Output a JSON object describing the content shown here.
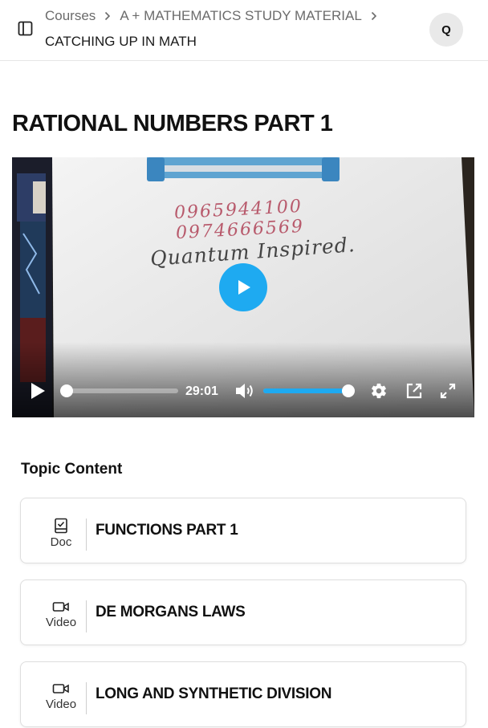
{
  "header": {
    "breadcrumbs": [
      "Courses",
      "A + MATHEMATICS STUDY MATERIAL"
    ],
    "current": "CATCHING UP IN MATH",
    "avatar_initial": "Q"
  },
  "page_title": "RATIONAL NUMBERS PART 1",
  "video": {
    "handwriting": {
      "phone_1": "0965944100",
      "phone_2": "0974666569",
      "signature": "Quantum Inspired."
    },
    "duration": "29:01",
    "progress": 0,
    "volume": 1.0,
    "accent_color": "#1eaaf1"
  },
  "topic_content": {
    "heading": "Topic Content",
    "items": [
      {
        "type": "Doc",
        "icon": "doc-icon",
        "title": "FUNCTIONS PART 1"
      },
      {
        "type": "Video",
        "icon": "video-icon",
        "title": "DE MORGANS LAWS"
      },
      {
        "type": "Video",
        "icon": "video-icon",
        "title": "LONG AND SYNTHETIC DIVISION"
      }
    ]
  }
}
